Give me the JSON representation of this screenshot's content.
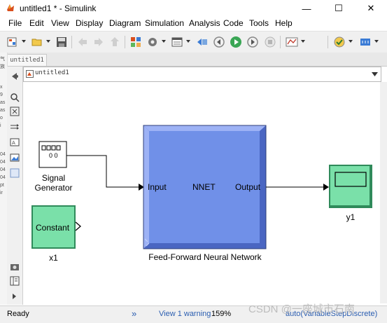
{
  "window": {
    "title": "untitled1 * - Simulink",
    "min_glyph": "—",
    "max_glyph": "☐",
    "close_glyph": "✕"
  },
  "menu": [
    "File",
    "Edit",
    "View",
    "Display",
    "Diagram",
    "Simulation",
    "Analysis",
    "Code",
    "Tools",
    "Help"
  ],
  "toolbar_icons": [
    "library-browser-icon",
    "open-model-icon",
    "save-icon",
    "back-icon",
    "forward-icon",
    "up-icon",
    "model-config-icon",
    "model-explorer-icon",
    "step-back-icon",
    "run-icon",
    "step-forward-icon",
    "stop-icon",
    "scope-icon",
    "check-model-icon",
    "build-icon"
  ],
  "tab": {
    "label": "untitled1"
  },
  "breadcrumb": {
    "path": "untitled1"
  },
  "left_strip_chars": [
    "气",
    "族",
    "x",
    "9",
    "as",
    "as",
    "o",
    "i",
    "04",
    "04",
    "04",
    "04",
    "pt",
    "ir"
  ],
  "blocks": {
    "signal_generator": {
      "label_line1": "Signal",
      "label_line2": "Generator",
      "dots": "0 0"
    },
    "constant": {
      "text": "Constant",
      "label": "x1"
    },
    "nnet": {
      "title": "NNET",
      "input": "Input",
      "output": "Output",
      "label": "Feed-Forward Neural Network"
    },
    "scope": {
      "label": "y1"
    }
  },
  "colors": {
    "nnet_fill": "#7090e8",
    "nnet_dark": "#4a66c2",
    "nnet_light": "#9db2f5",
    "green_fill": "#7ae0a9",
    "green_dark": "#2f8a5a"
  },
  "status": {
    "ready": "Ready",
    "warning": "View 1 warning",
    "zoom": "159%",
    "solver": "auto(VariableStepDiscrete)",
    "warning_glyph": "»"
  },
  "watermark": "CSDN @一座城市石南"
}
